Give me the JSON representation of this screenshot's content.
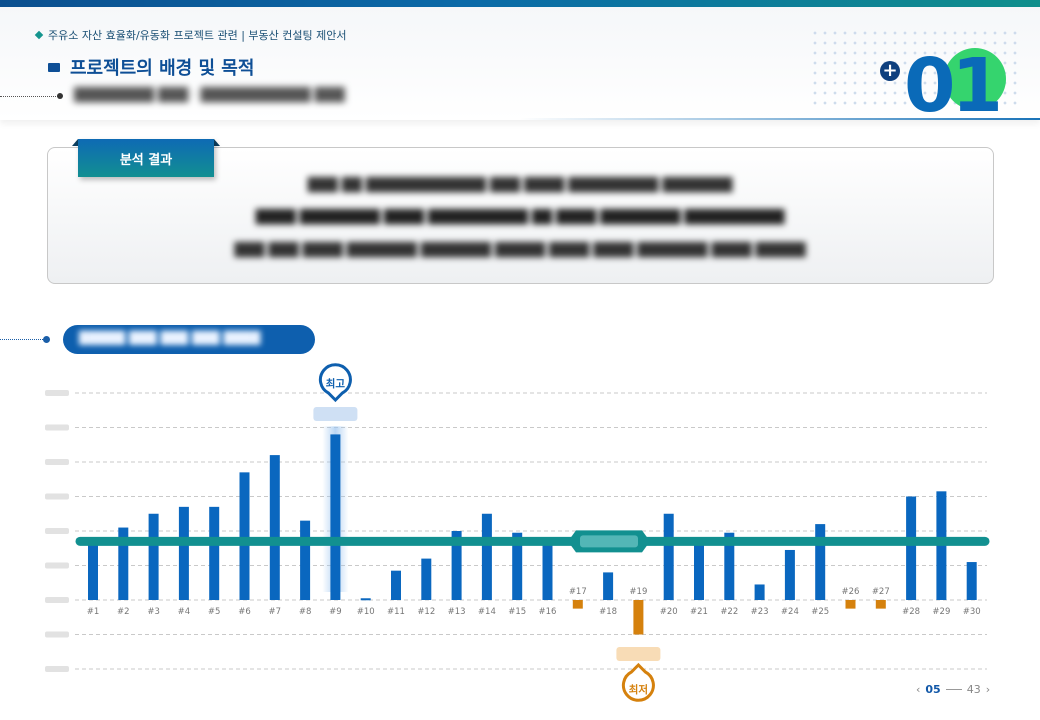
{
  "header": {
    "breadcrumb": "주유소 자산 효율화/유동화 프로젝트 관련 | 부동산 컨설팅 제안서",
    "title": "프로젝트의 배경 및 목적",
    "subtitle": "████████ ███ · ███████████ ███",
    "page_badge": "01"
  },
  "summary": {
    "tab_label": "분석 결과",
    "lines": [
      "███ ██ ████████████ ███ ████ █████████ ███████",
      "████ ████████ ████ ██████████ ██ ████ ████████ ██████████",
      "███ ███ ████ ███████ ███████ █████ ████ ████ ███████ ████ █████"
    ]
  },
  "section": {
    "pill_label": "█████ ███ ███ ███ ████"
  },
  "pager": {
    "current": "05",
    "total": "43"
  },
  "colors": {
    "bar_positive": "#0a67bf",
    "bar_negative": "#d5810d",
    "average_line": "#129090",
    "highest_marker": "#0e5fae",
    "lowest_marker": "#d5810d"
  },
  "chart_data": {
    "type": "bar",
    "categories": [
      "#1",
      "#2",
      "#3",
      "#4",
      "#5",
      "#6",
      "#7",
      "#8",
      "#9",
      "#10",
      "#11",
      "#12",
      "#13",
      "#14",
      "#15",
      "#16",
      "#17",
      "#18",
      "#19",
      "#20",
      "#21",
      "#22",
      "#23",
      "#24",
      "#25",
      "#26",
      "#27",
      "#28",
      "#29",
      "#30"
    ],
    "values": [
      1.6,
      2.1,
      2.5,
      2.7,
      2.7,
      3.7,
      4.2,
      2.3,
      4.8,
      0.05,
      0.85,
      1.2,
      2.0,
      2.5,
      1.95,
      1.7,
      -0.25,
      0.8,
      -1.0,
      2.5,
      1.65,
      1.95,
      0.45,
      1.45,
      2.2,
      -0.25,
      -0.25,
      3.0,
      3.15,
      1.1
    ],
    "average": 1.7,
    "ylim": [
      -2,
      6
    ],
    "grid": true,
    "annotations": {
      "highest_label": "최고",
      "highest_index": 8,
      "lowest_label": "최저",
      "lowest_index": 18
    }
  }
}
